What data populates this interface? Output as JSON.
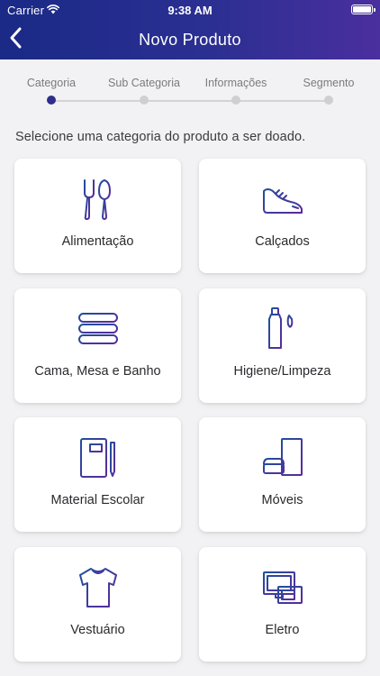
{
  "status_bar": {
    "carrier": "Carrier",
    "time": "9:38 AM",
    "battery_level": 1.0
  },
  "nav": {
    "title": "Novo Produto",
    "back_icon": "chevron-left-icon"
  },
  "stepper": {
    "steps": [
      {
        "label": "Categoria",
        "active": true
      },
      {
        "label": "Sub Categoria",
        "active": false
      },
      {
        "label": "Informações",
        "active": false
      },
      {
        "label": "Segmento",
        "active": false
      }
    ]
  },
  "instructions": "Selecione uma categoria do produto a ser doado.",
  "categories": [
    {
      "label": "Alimentação",
      "icon": "cutlery-icon"
    },
    {
      "label": "Calçados",
      "icon": "sneaker-icon"
    },
    {
      "label": "Cama, Mesa e Banho",
      "icon": "towels-icon"
    },
    {
      "label": "Higiene/Limpeza",
      "icon": "toothpaste-icon"
    },
    {
      "label": "Material Escolar",
      "icon": "notebook-icon"
    },
    {
      "label": "Móveis",
      "icon": "furniture-icon"
    },
    {
      "label": "Vestuário",
      "icon": "tshirt-icon"
    },
    {
      "label": "Eletro",
      "icon": "appliance-icon"
    }
  ],
  "colors": {
    "header_start": "#1a2a86",
    "header_end": "#4a2f9e",
    "icon_start": "#1f4f9c",
    "icon_end": "#5b2a9c",
    "active_step": "#2e2f8c",
    "inactive_step": "#cfcfd3"
  }
}
